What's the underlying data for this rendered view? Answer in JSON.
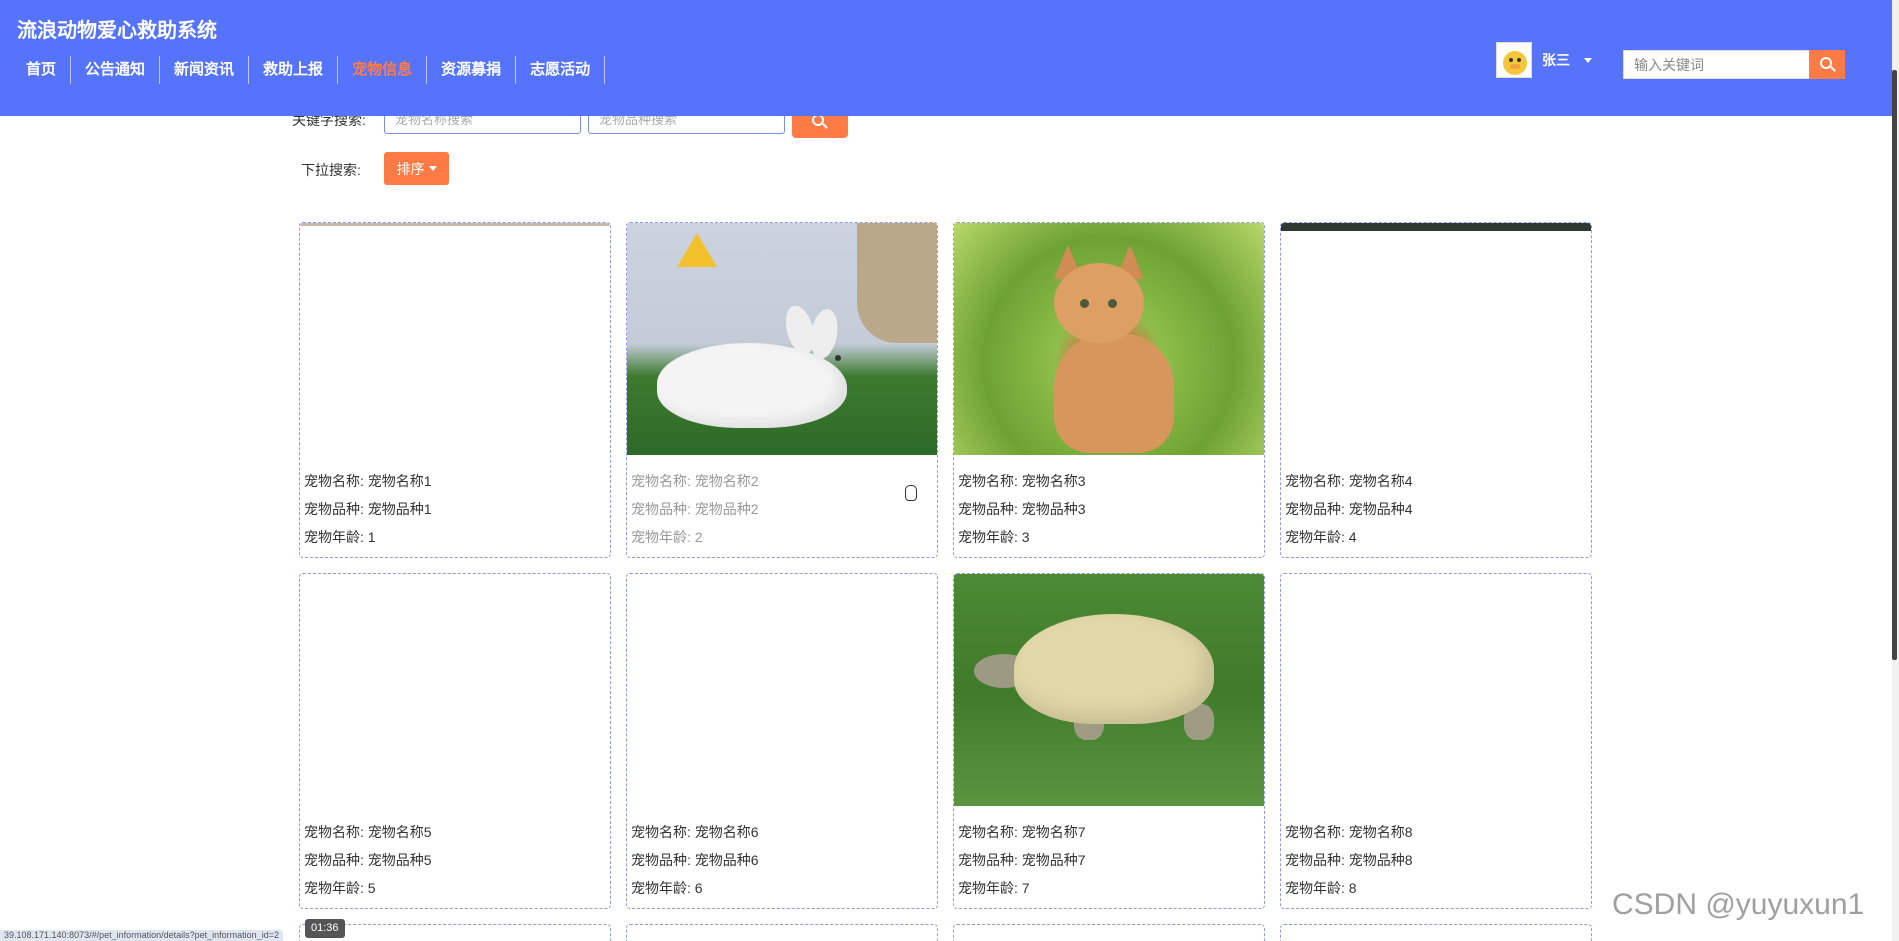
{
  "header": {
    "site_title": "流浪动物爱心救助系统",
    "nav": [
      {
        "label": "首页",
        "active": false
      },
      {
        "label": "公告通知",
        "active": false
      },
      {
        "label": "新闻资讯",
        "active": false
      },
      {
        "label": "救助上报",
        "active": false
      },
      {
        "label": "宠物信息",
        "active": true
      },
      {
        "label": "资源募捐",
        "active": false
      },
      {
        "label": "志愿活动",
        "active": false
      }
    ],
    "user": {
      "name": "张三"
    },
    "search": {
      "placeholder": "输入关键词"
    }
  },
  "filters": {
    "keyword_label": "关键字搜索:",
    "name_placeholder": "宠物名称搜索",
    "breed_placeholder": "宠物品种搜索",
    "dropdown_label": "下拉搜索:",
    "sort_label": "排序"
  },
  "cards": [
    {
      "name": "宠物名称: 宠物名称1",
      "breed": "宠物品种: 宠物品种1",
      "age": "宠物年龄: 1"
    },
    {
      "name": "宠物名称: 宠物名称2",
      "breed": "宠物品种: 宠物品种2",
      "age": "宠物年龄: 2"
    },
    {
      "name": "宠物名称: 宠物名称3",
      "breed": "宠物品种: 宠物品种3",
      "age": "宠物年龄: 3"
    },
    {
      "name": "宠物名称: 宠物名称4",
      "breed": "宠物品种: 宠物品种4",
      "age": "宠物年龄: 4"
    },
    {
      "name": "宠物名称: 宠物名称5",
      "breed": "宠物品种: 宠物品种5",
      "age": "宠物年龄: 5"
    },
    {
      "name": "宠物名称: 宠物名称6",
      "breed": "宠物品种: 宠物品种6",
      "age": "宠物年龄: 6"
    },
    {
      "name": "宠物名称: 宠物名称7",
      "breed": "宠物品种: 宠物品种7",
      "age": "宠物年龄: 7"
    },
    {
      "name": "宠物名称: 宠物名称8",
      "breed": "宠物品种: 宠物品种8",
      "age": "宠物年龄: 8"
    }
  ],
  "overlay": {
    "status_url": "39.108.171.140:8073/#/pet_information/details?pet_information_id=2",
    "video_time": "01:36",
    "watermark": "CSDN @yuyuxun1"
  },
  "colors": {
    "header_bg": "#5574fb",
    "accent": "#ff7b46",
    "card_border": "#8f98e6"
  }
}
